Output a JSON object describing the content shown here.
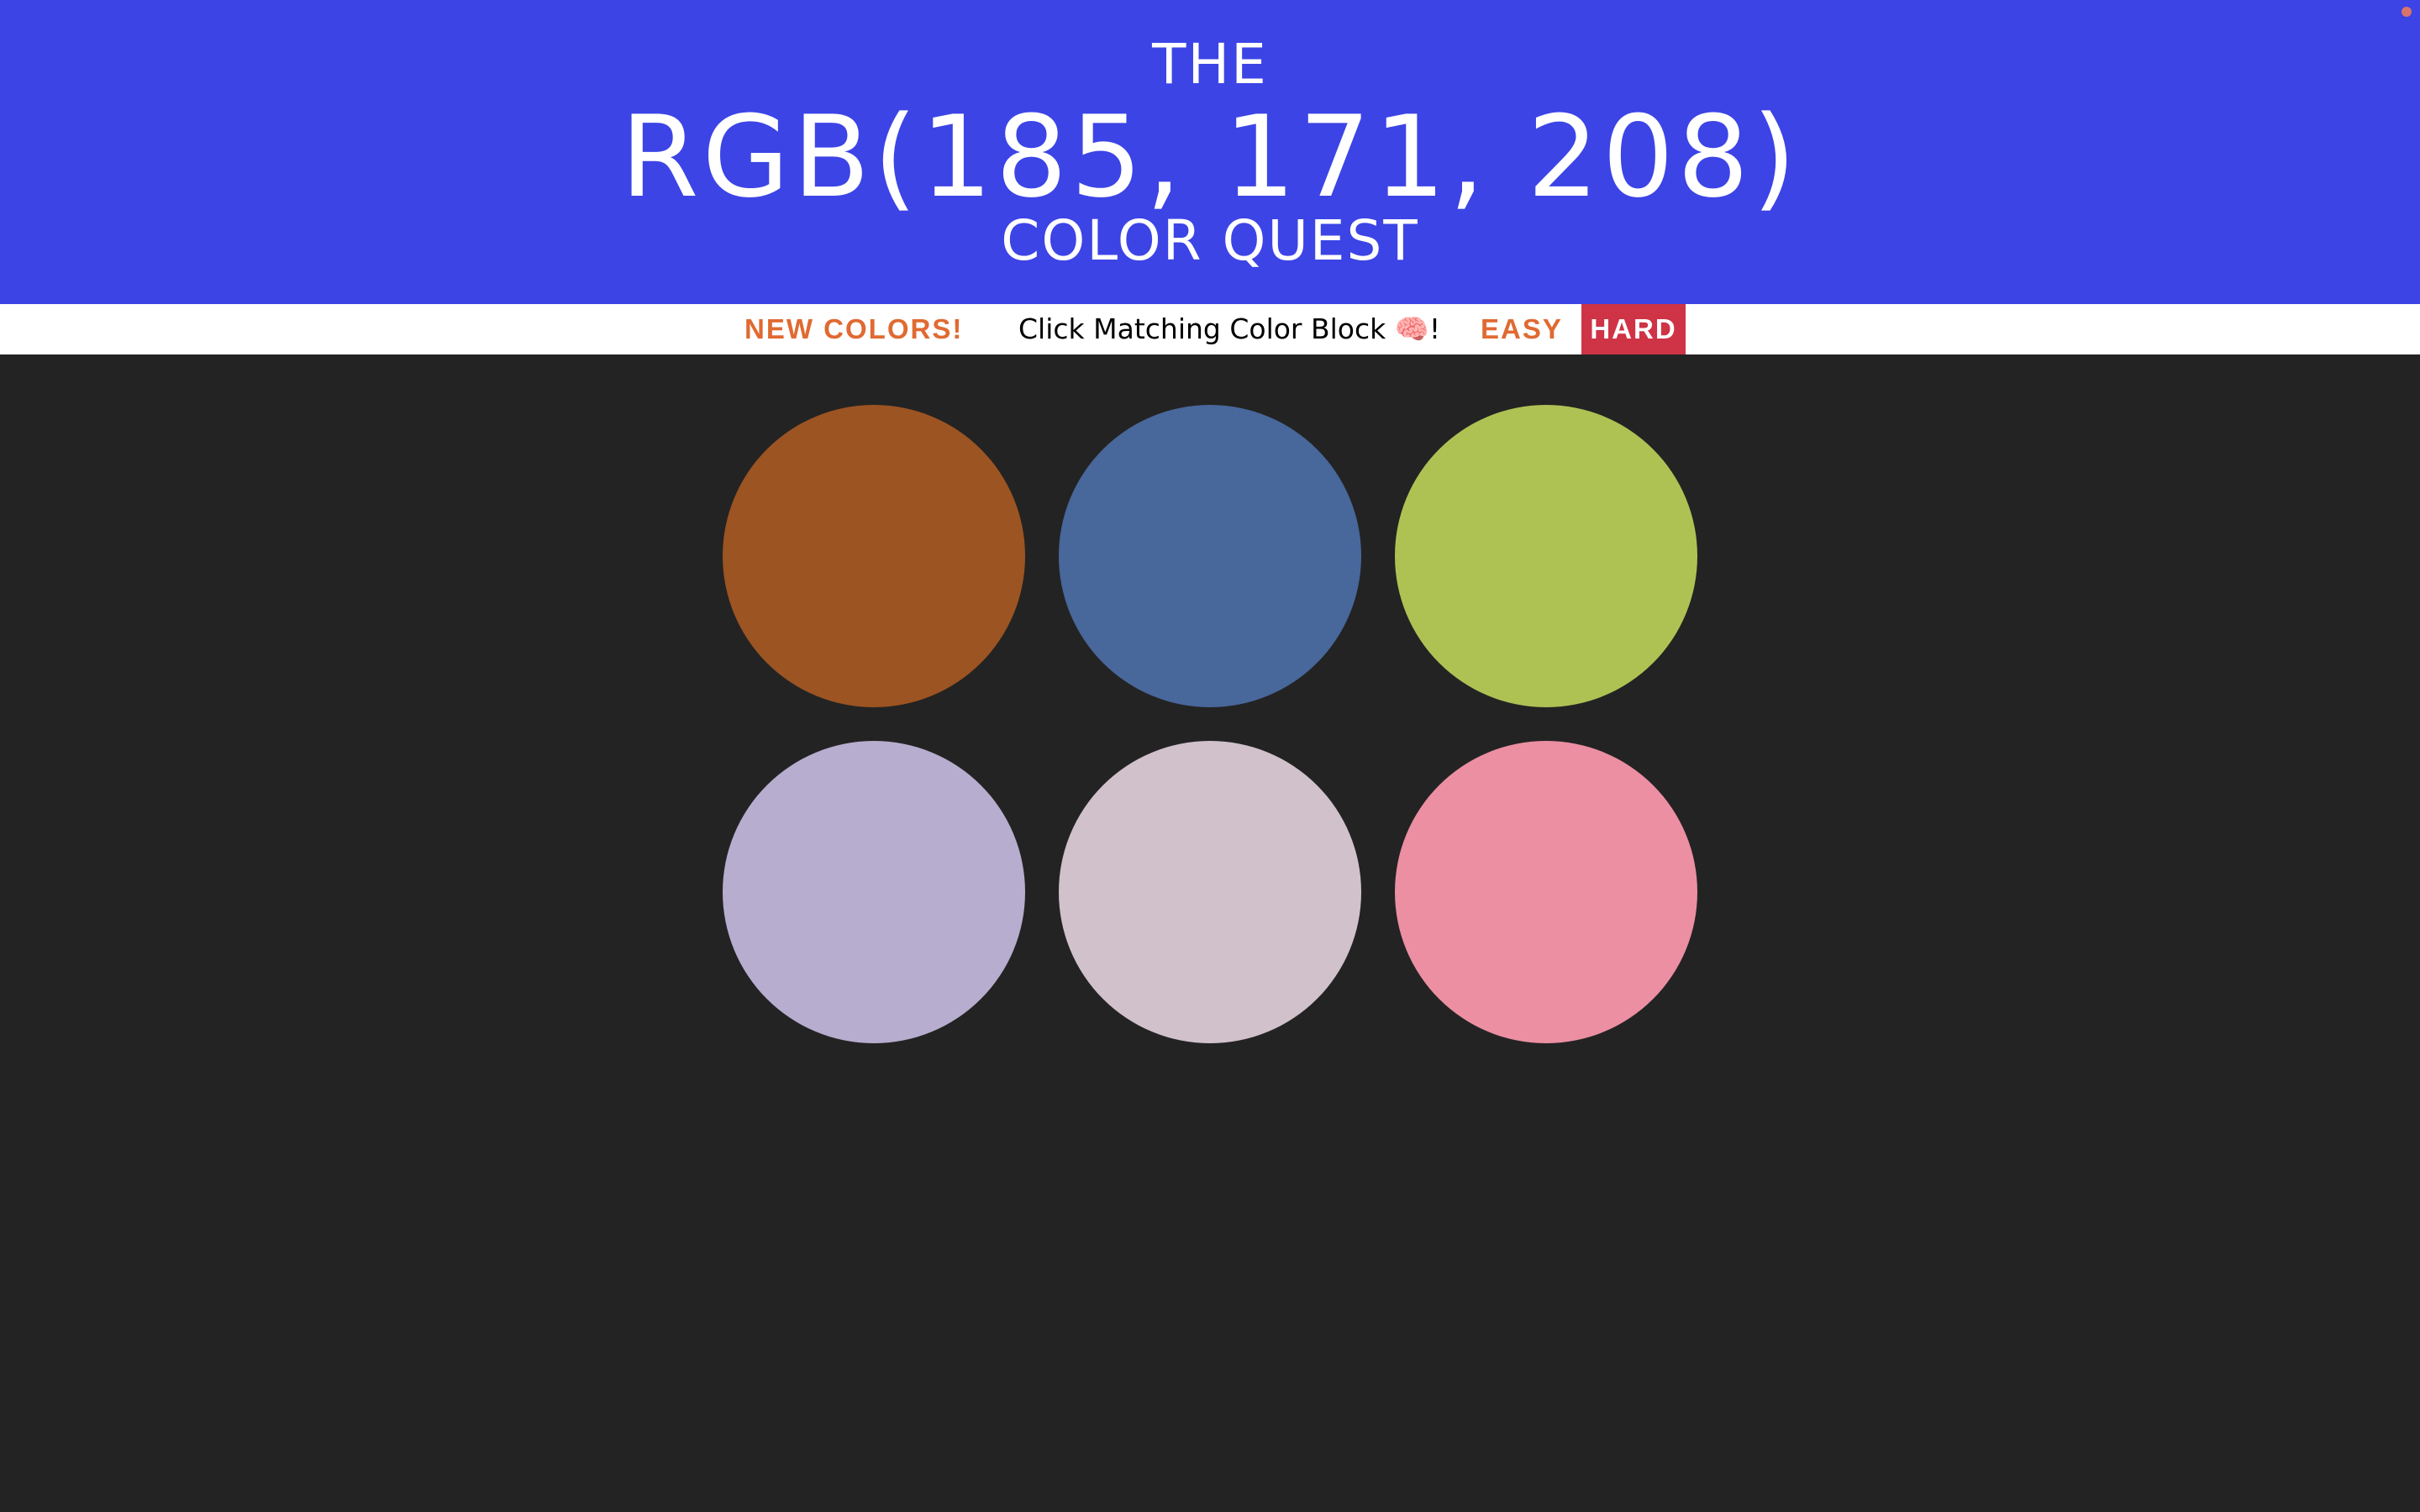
{
  "header": {
    "line1": "THE",
    "target_color": "RGB(185, 171, 208)",
    "line3": "COLOR QUEST",
    "background": "#3c44e6"
  },
  "toolbar": {
    "new_colors_label": "NEW COLORS!",
    "message": "Click Matching Color Block 🧠!",
    "easy_label": "EASY",
    "hard_label": "HARD",
    "selected_mode": "HARD",
    "accent_color": "#e06a32",
    "selected_color": "#cf3346"
  },
  "board": {
    "background": "#232323",
    "swatch_colors": [
      "#9c5422",
      "#48679b",
      "#aec254",
      "#b6adcf",
      "#d0c1ca",
      "#ec8fa3"
    ]
  }
}
